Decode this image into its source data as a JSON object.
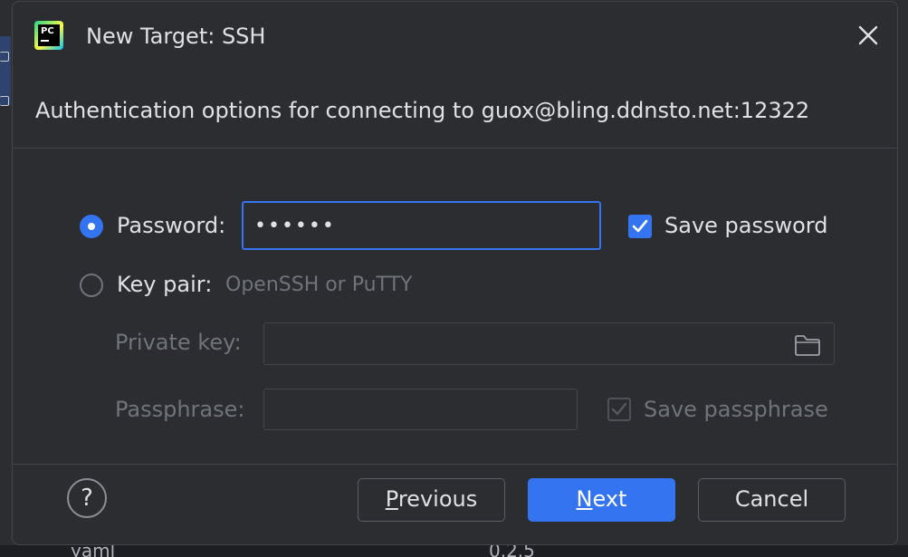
{
  "dialog": {
    "title": "New Target: SSH",
    "subtitle": "Authentication options for connecting to guox@bling.ddnsto.net:12322"
  },
  "auth": {
    "password": {
      "label": "Password:",
      "value": "••••••",
      "selected": true,
      "save_label": "Save password",
      "save_checked": true
    },
    "key_pair": {
      "label": "Key pair:",
      "hint": "OpenSSH or PuTTY",
      "selected": false,
      "private_key_label": "Private key:",
      "private_key_value": "",
      "passphrase_label": "Passphrase:",
      "passphrase_value": "",
      "save_passphrase_label": "Save passphrase",
      "save_passphrase_checked": true,
      "enabled": false
    }
  },
  "footer": {
    "help_label": "?",
    "previous": {
      "mnemonic": "P",
      "rest": "revious"
    },
    "next": {
      "mnemonic": "N",
      "rest": "ext"
    },
    "cancel_label": "Cancel"
  },
  "background": {
    "row_name": "yaml",
    "row_version": "0.2.5"
  },
  "colors": {
    "accent": "#3574f0",
    "dialog_bg": "#2b2d30",
    "text": "#dfe1e5",
    "disabled_text": "#6f737a"
  }
}
